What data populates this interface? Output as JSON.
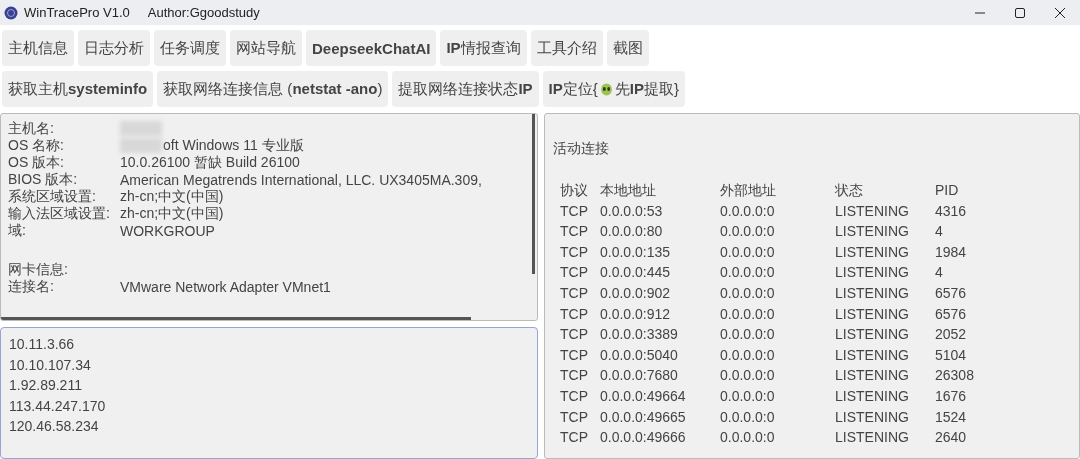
{
  "window": {
    "title": "WinTracePro V1.0",
    "author": "Author:Ggoodstudy"
  },
  "nav_buttons": [
    {
      "label": "主机信息"
    },
    {
      "label": "日志分析"
    },
    {
      "label": "任务调度"
    },
    {
      "label": "网站导航"
    },
    {
      "label": "**DeepseekChatAI**"
    },
    {
      "label": "**IP**情报查询"
    },
    {
      "label": "工具介绍"
    },
    {
      "label": "截图"
    }
  ],
  "action_buttons": [
    {
      "kind": "text",
      "label": "获取主机**systeminfo**"
    },
    {
      "kind": "text",
      "label": "获取网络连接信息 (**netstat -ano**)"
    },
    {
      "kind": "text",
      "label": "提取网络连接状态**IP**"
    },
    {
      "kind": "icon",
      "label": "**IP**定位{",
      "label_after": "先**IP**提取}"
    }
  ],
  "system_info": [
    {
      "label": "主机名:",
      "redacted": true
    },
    {
      "label": "OS 名称:",
      "value": "oft Windows 11 专业版",
      "redacted": true
    },
    {
      "label": "OS 版本:",
      "value": "10.0.26100 暂缺  Build 26100",
      "redacted": false
    },
    {
      "label": "BIOS 版本:",
      "value": "American Megatrends International, LLC. UX3405MA.309,",
      "redacted": false
    },
    {
      "label": "系统区域设置:",
      "value": "zh-cn;中文(中国)",
      "redacted": false
    },
    {
      "label": "输入法区域设置:",
      "value": "zh-cn;中文(中国)",
      "redacted": false
    },
    {
      "label": "域:",
      "value": "WORKGROUP",
      "redacted": false
    },
    {
      "label": "网卡信息:",
      "redacted": false
    },
    {
      "label": "连接名:",
      "value": "VMware Network Adapter VMnet1",
      "redacted": false
    }
  ],
  "ip_list": [
    "10.11.3.66",
    "10.10.107.34",
    "1.92.89.211",
    "113.44.247.170",
    "120.46.58.234"
  ],
  "connections": {
    "title": "活动连接",
    "columns": [
      "协议",
      "本地地址",
      "外部地址",
      "状态",
      "PID"
    ],
    "rows": [
      [
        "TCP",
        "0.0.0.0:53",
        "0.0.0.0:0",
        "LISTENING",
        "4316"
      ],
      [
        "TCP",
        "0.0.0.0:80",
        "0.0.0.0:0",
        "LISTENING",
        "4"
      ],
      [
        "TCP",
        "0.0.0.0:135",
        "0.0.0.0:0",
        "LISTENING",
        "1984"
      ],
      [
        "TCP",
        "0.0.0.0:445",
        "0.0.0.0:0",
        "LISTENING",
        "4"
      ],
      [
        "TCP",
        "0.0.0.0:902",
        "0.0.0.0:0",
        "LISTENING",
        "6576"
      ],
      [
        "TCP",
        "0.0.0.0:912",
        "0.0.0.0:0",
        "LISTENING",
        "6576"
      ],
      [
        "TCP",
        "0.0.0.0:3389",
        "0.0.0.0:0",
        "LISTENING",
        "2052"
      ],
      [
        "TCP",
        "0.0.0.0:5040",
        "0.0.0.0:0",
        "LISTENING",
        "5104"
      ],
      [
        "TCP",
        "0.0.0.0:7680",
        "0.0.0.0:0",
        "LISTENING",
        "26308"
      ],
      [
        "TCP",
        "0.0.0.0:49664",
        "0.0.0.0:0",
        "LISTENING",
        "1676"
      ],
      [
        "TCP",
        "0.0.0.0:49665",
        "0.0.0.0:0",
        "LISTENING",
        "1524"
      ],
      [
        "TCP",
        "0.0.0.0:49666",
        "0.0.0.0:0",
        "LISTENING",
        "2640"
      ]
    ]
  }
}
